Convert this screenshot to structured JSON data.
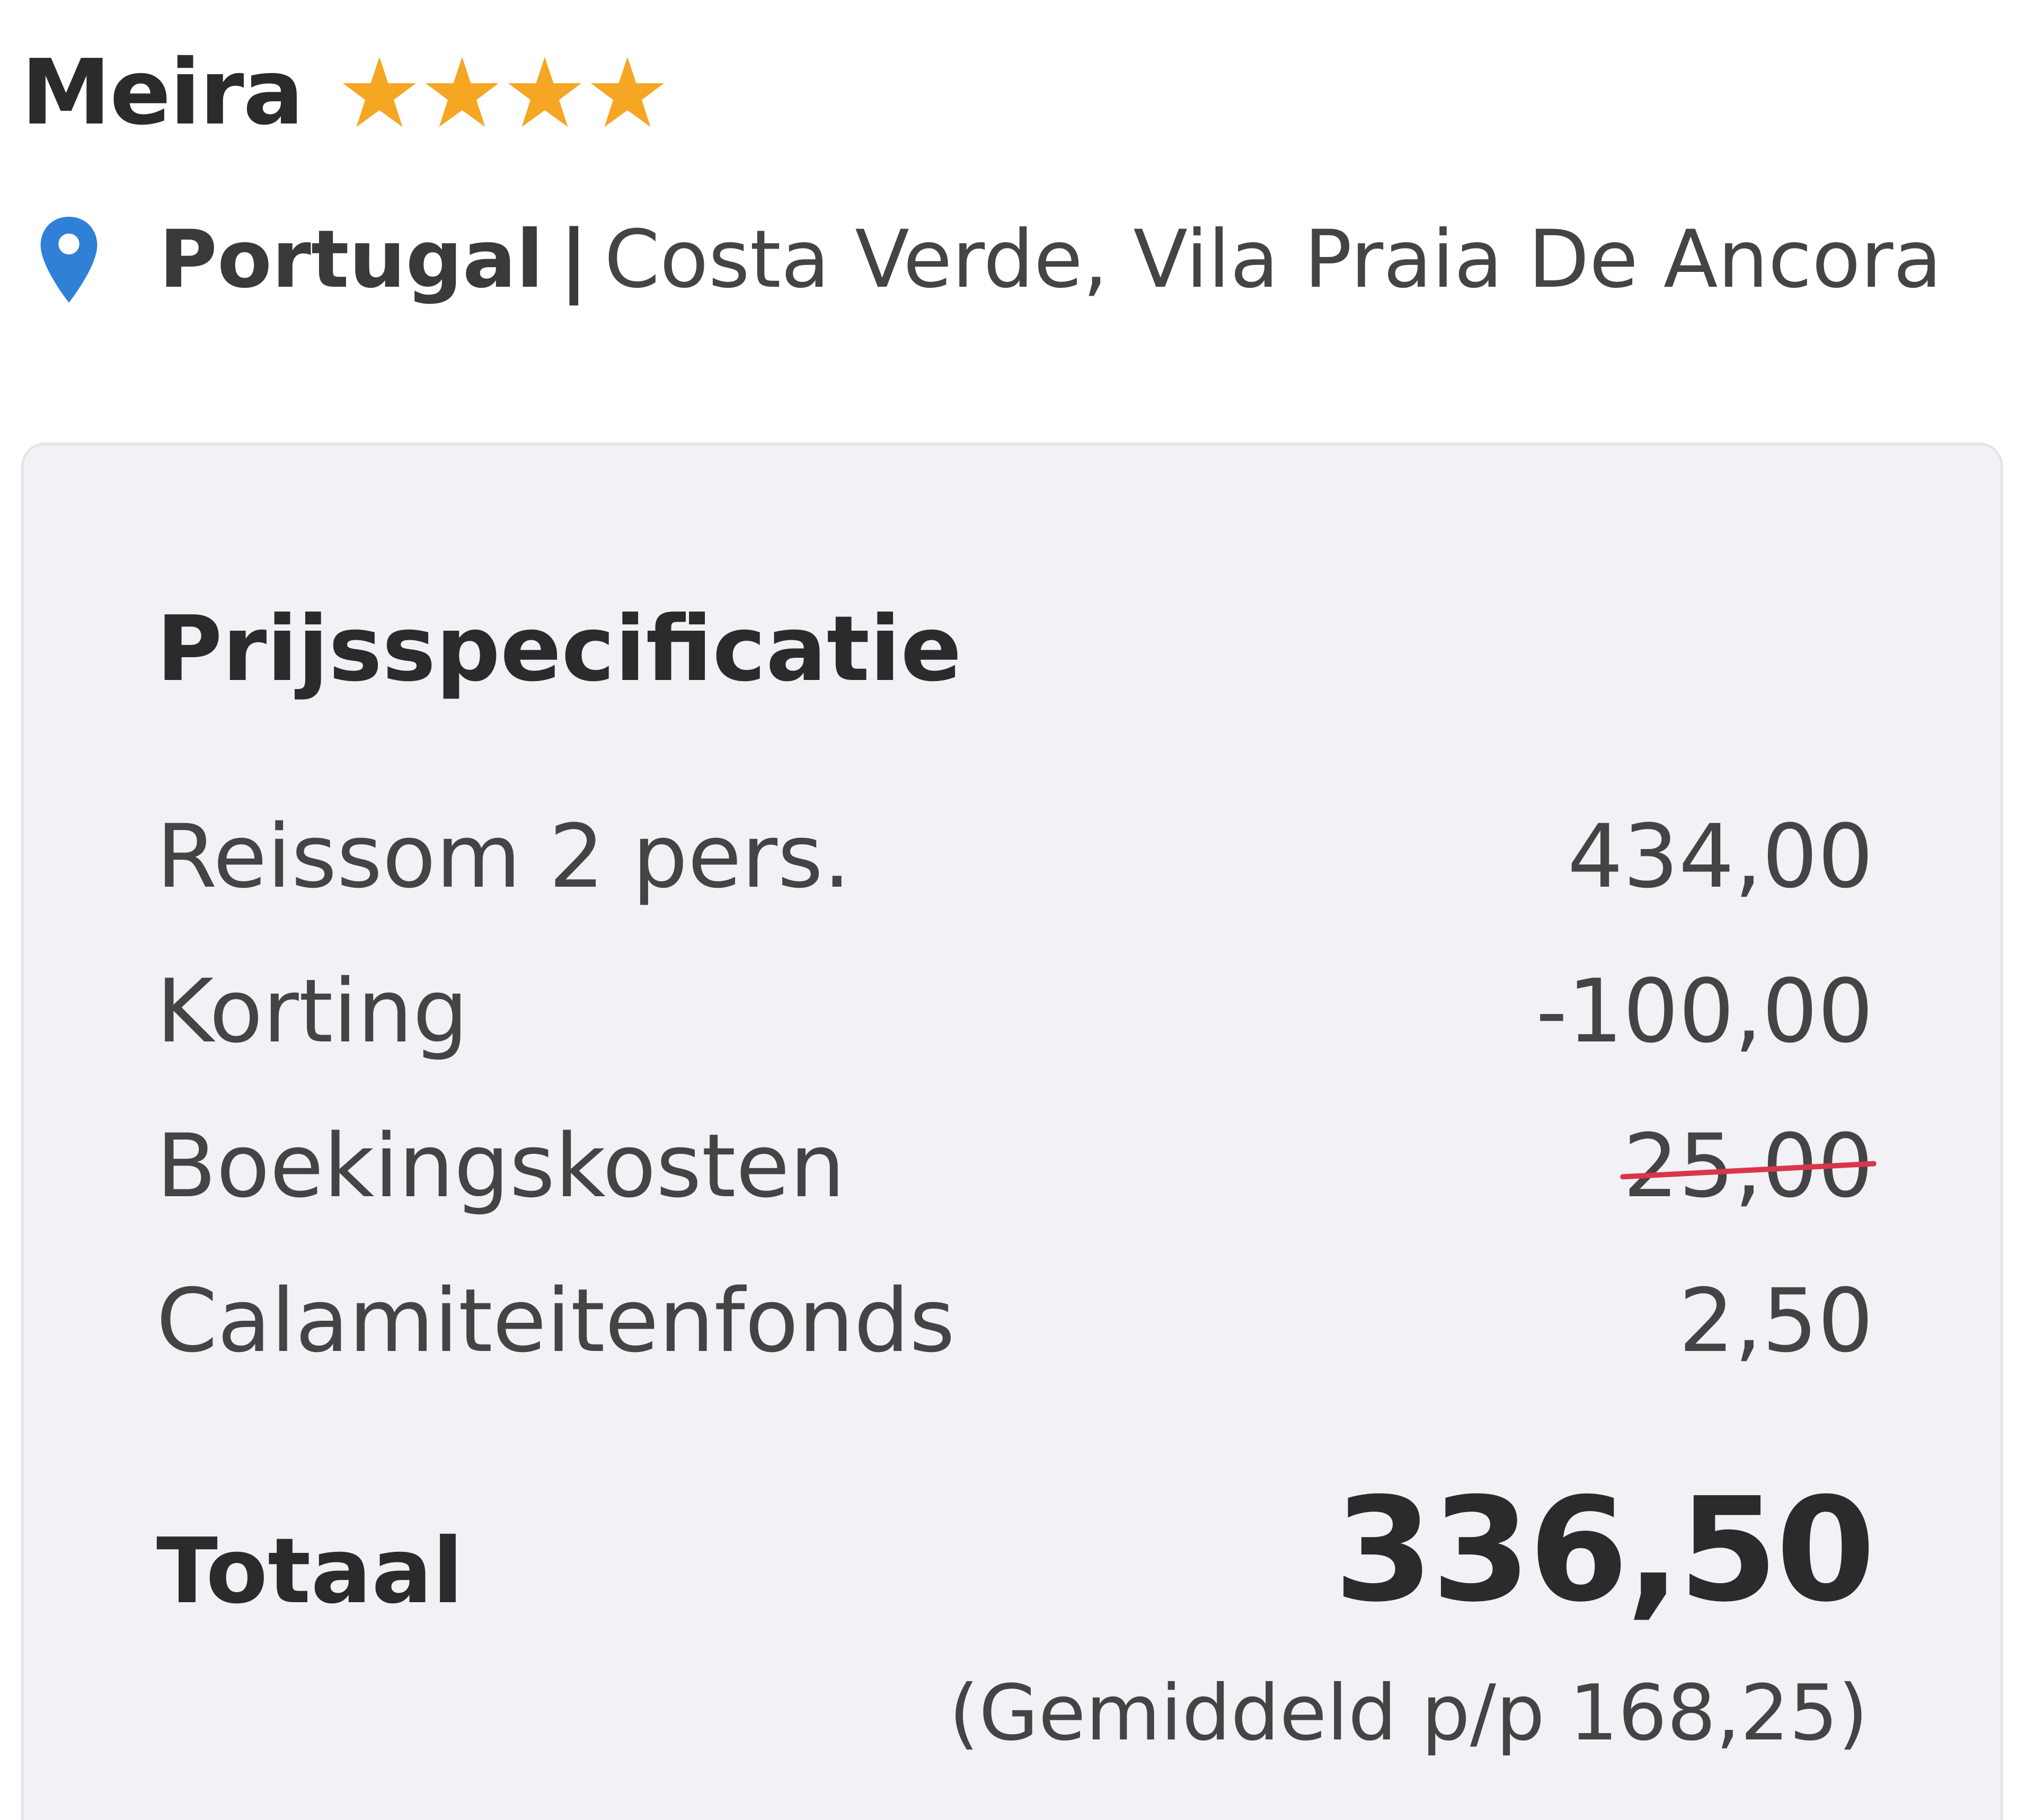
{
  "hotel": {
    "name": "Meira",
    "star_rating": 4,
    "star_color": "#f5a623"
  },
  "location": {
    "icon": "map-pin-icon",
    "icon_color": "#2f80d6",
    "country": "Portugal",
    "separator": "|",
    "region": "Costa Verde, Vila Praia De Ancora"
  },
  "price_spec": {
    "title": "Prijsspecificatie",
    "rows": [
      {
        "label": "Reissom 2 pers.",
        "value": "434,00",
        "struck": false
      },
      {
        "label": "Korting",
        "value": "-100,00",
        "struck": false
      },
      {
        "label": "Boekingskosten",
        "value": "25,00",
        "struck": true,
        "strike_color": "#d9364a"
      },
      {
        "label": "Calamiteitenfonds",
        "value": "2,50",
        "struck": false
      }
    ],
    "total_label": "Totaal",
    "total_value": "336,50",
    "average_note": "(Gemiddeld p/p 168,25)"
  }
}
